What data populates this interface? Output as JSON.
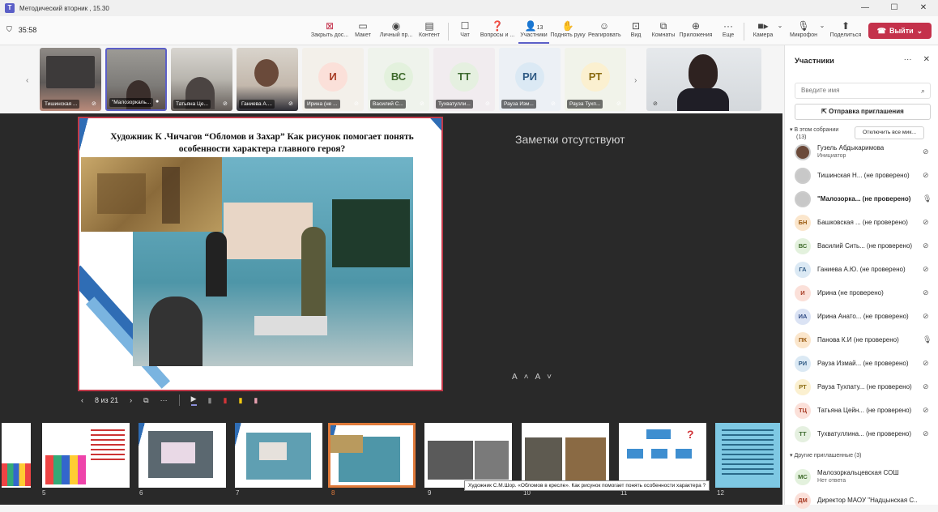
{
  "window": {
    "title": "Методический вторник , 15.30"
  },
  "toolbar": {
    "timer": "35:58",
    "items": [
      {
        "label": "Закрыть дос...",
        "icon": "stop-share-icon"
      },
      {
        "label": "Макет",
        "icon": "layout-icon"
      },
      {
        "label": "Личный пр...",
        "icon": "eye-icon"
      },
      {
        "label": "Контент",
        "icon": "content-icon"
      },
      {
        "label": "Чат",
        "icon": "chat-icon"
      },
      {
        "label": "Вопросы и ...",
        "icon": "qa-icon"
      },
      {
        "label": "Участники",
        "icon": "people-icon",
        "count": "13"
      },
      {
        "label": "Поднять руку",
        "icon": "hand-icon"
      },
      {
        "label": "Реагировать",
        "icon": "smile-icon"
      },
      {
        "label": "Вид",
        "icon": "view-icon"
      },
      {
        "label": "Комнаты",
        "icon": "rooms-icon"
      },
      {
        "label": "Приложения",
        "icon": "plus-icon"
      },
      {
        "label": "Еще",
        "icon": "more-icon"
      },
      {
        "label": "Камера",
        "icon": "camera-icon"
      },
      {
        "label": "Микрофон",
        "icon": "mic-off-icon"
      },
      {
        "label": "Поделиться",
        "icon": "share-icon"
      }
    ],
    "leave_label": "Выйти"
  },
  "gallery": [
    {
      "name": "Тишинская ..."
    },
    {
      "name": "\"Малозоркаль..."
    },
    {
      "name": "Татьяна Це..."
    },
    {
      "name": "Ганиева А...."
    },
    {
      "name": "Ирина (не ...",
      "initials": "И",
      "bg": "#fbe0d9",
      "fg": "#a63a23"
    },
    {
      "name": "Василий С...",
      "initials": "ВС",
      "bg": "#e3f1dd",
      "fg": "#3f6b2c"
    },
    {
      "name": "Тухватулли...",
      "initials": "ТТ",
      "bg": "#e5f0e0",
      "fg": "#3d6a2f"
    },
    {
      "name": "Рауза Изм...",
      "initials": "РИ",
      "bg": "#dbe9f4",
      "fg": "#2f5a84"
    },
    {
      "name": "Рауза Тухп...",
      "initials": "РТ",
      "bg": "#fbf0d0",
      "fg": "#8a6a10"
    }
  ],
  "slide": {
    "title": "Художник К .Чичагов “Обломов и Захар” Как рисунок помогает понять особенности характера главного героя?",
    "counter": "8 из 21"
  },
  "notes_text": "Заметки отсутствуют",
  "font_controls": [
    "A˄",
    "A˅"
  ],
  "filmstrip": {
    "numbers": [
      "5",
      "6",
      "7",
      "8",
      "9",
      "10",
      "11",
      "12"
    ],
    "tooltip": "Художник С.М.Шор. «Обломов в кресле». Как рисунок помогает понять особенности характера ?"
  },
  "panel": {
    "title": "Участники",
    "search_placeholder": "Введите имя",
    "invite_label": "Отправка приглашения",
    "in_meeting_label": "В этом собрании",
    "in_meeting_count": "(13)",
    "mute_all_label": "Отключить все мик...",
    "participants": [
      {
        "initials": "",
        "name": "Гузель Абдыкаримова",
        "role": "Инициатор",
        "bg": "#6b4a3a",
        "fg": "#fff",
        "mic": "mic-off-icon"
      },
      {
        "initials": "",
        "name": "Тишинская Н... (не проверено)",
        "role": "",
        "bg": "#c8c8c8",
        "fg": "#fff",
        "mic": "mic-off-icon"
      },
      {
        "initials": "",
        "name": "\"Малозорка... (не проверено)",
        "role": "",
        "bg": "#c8c8c8",
        "fg": "#fff",
        "mic": "mic-on-icon"
      },
      {
        "initials": "БН",
        "name": "Башковская ... (не проверено)",
        "role": "",
        "bg": "#fbe6cc",
        "fg": "#9a5a10",
        "mic": "mic-off-icon"
      },
      {
        "initials": "ВС",
        "name": "Василий Сить... (не проверено)",
        "role": "",
        "bg": "#e3f1dd",
        "fg": "#3f6b2c",
        "mic": "mic-off-icon"
      },
      {
        "initials": "ГА",
        "name": "Ганиева А.Ю. (не проверено)",
        "role": "",
        "bg": "#dbe9f4",
        "fg": "#2f5a84",
        "mic": "mic-off-icon"
      },
      {
        "initials": "И",
        "name": "Ирина (не проверено)",
        "role": "",
        "bg": "#fbe0d9",
        "fg": "#a63a23",
        "mic": "mic-off-icon"
      },
      {
        "initials": "ИА",
        "name": "Ирина Анато... (не проверено)",
        "role": "",
        "bg": "#dbe3f4",
        "fg": "#2f4a84",
        "mic": "mic-off-icon"
      },
      {
        "initials": "ПК",
        "name": "Панова К.И (не проверено)",
        "role": "",
        "bg": "#fbe6cc",
        "fg": "#9a5a10",
        "mic": "mic-on-icon"
      },
      {
        "initials": "РИ",
        "name": "Рауза Измай... (не проверено)",
        "role": "",
        "bg": "#dbe9f4",
        "fg": "#2f5a84",
        "mic": "mic-off-icon"
      },
      {
        "initials": "РТ",
        "name": "Рауза Тухпату... (не проверено)",
        "role": "",
        "bg": "#fbf0d0",
        "fg": "#8a6a10",
        "mic": "mic-off-icon"
      },
      {
        "initials": "ТЦ",
        "name": "Татьяна Цейн... (не проверено)",
        "role": "",
        "bg": "#fbe0d9",
        "fg": "#a63a23",
        "mic": "mic-off-icon"
      },
      {
        "initials": "ТТ",
        "name": "Тухватуллина... (не проверено)",
        "role": "",
        "bg": "#e5f0e0",
        "fg": "#3d6a2f",
        "mic": "mic-off-icon"
      }
    ],
    "others_label": "Другие приглашенные (3)",
    "others": [
      {
        "initials": "МС",
        "name": "Малозоркальцевская СОШ",
        "role": "Нет ответа",
        "bg": "#e3f1dd",
        "fg": "#3f6b2c"
      },
      {
        "initials": "ДМ",
        "name": "Директор МАОУ \"Надцынская С...",
        "role": "",
        "bg": "#fbe0d9",
        "fg": "#a63a23"
      }
    ]
  }
}
